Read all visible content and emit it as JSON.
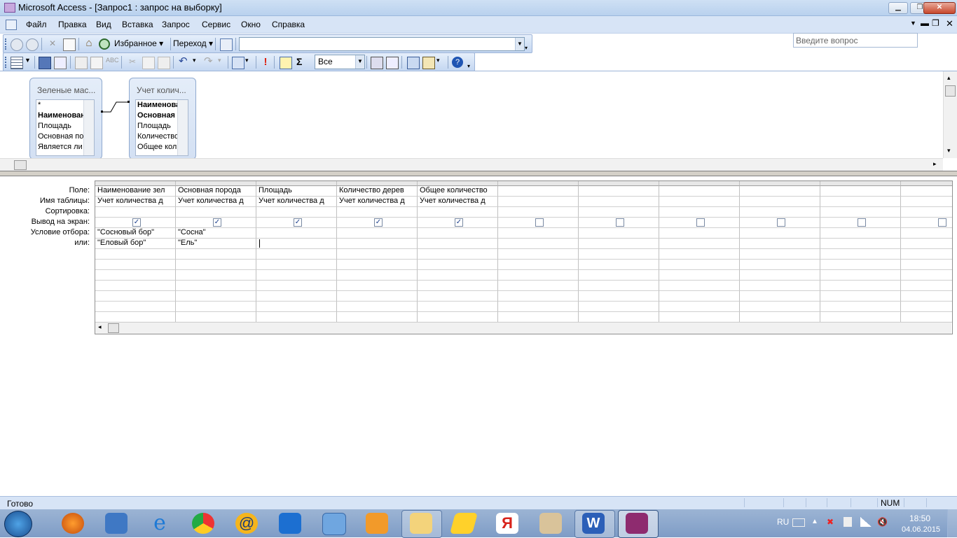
{
  "window": {
    "title": "Microsoft Access - [Запрос1 : запрос на выборку]"
  },
  "menu": {
    "items": [
      "Файл",
      "Правка",
      "Вид",
      "Вставка",
      "Запрос",
      "Сервис",
      "Окно",
      "Справка"
    ]
  },
  "help_box": {
    "placeholder": "Введите вопрос"
  },
  "toolbar1": {
    "favorites": "Избранное",
    "goto": "Переход"
  },
  "toolbar2": {
    "topvalues": "Все",
    "sigma": "Σ"
  },
  "tables": [
    {
      "header": "Зеленые мас...",
      "fields": [
        "*",
        "Наименовани",
        "Площадь",
        "Основная пор",
        "Является ли"
      ],
      "bold": [
        1
      ]
    },
    {
      "header": "Учет колич...",
      "fields": [
        "Наименова",
        "Основная п",
        "Площадь",
        "Количество",
        "Общее коли"
      ],
      "bold": [
        0,
        1
      ]
    }
  ],
  "grid": {
    "row_labels": [
      "Поле:",
      "Имя таблицы:",
      "Сортировка:",
      "Вывод на экран:",
      "Условие отбора:",
      "или:"
    ],
    "columns": [
      {
        "field": "Наименование зел",
        "table": "Учет количества д",
        "show": true,
        "criteria": "\"Сосновый бор\"",
        "or": "\"Еловый бор\""
      },
      {
        "field": "Основная порода",
        "table": "Учет количества д",
        "show": true,
        "criteria": "\"Сосна\"",
        "or": "\"Ель\""
      },
      {
        "field": "Площадь",
        "table": "Учет количества д",
        "show": true,
        "criteria": "",
        "or": ""
      },
      {
        "field": "Количество дерев",
        "table": "Учет количества д",
        "show": true,
        "criteria": "",
        "or": ""
      },
      {
        "field": "Общее количество",
        "table": "Учет количества д",
        "show": true,
        "criteria": "",
        "or": ""
      },
      {
        "field": "",
        "table": "",
        "show": false,
        "criteria": "",
        "or": ""
      },
      {
        "field": "",
        "table": "",
        "show": false,
        "criteria": "",
        "or": ""
      },
      {
        "field": "",
        "table": "",
        "show": false,
        "criteria": "",
        "or": ""
      },
      {
        "field": "",
        "table": "",
        "show": false,
        "criteria": "",
        "or": ""
      },
      {
        "field": "",
        "table": "",
        "show": false,
        "criteria": "",
        "or": ""
      },
      {
        "field": "",
        "table": "",
        "show": false,
        "criteria": "",
        "or": ""
      }
    ]
  },
  "status": {
    "text": "Готово",
    "num": "NUM"
  },
  "taskbar": {
    "lang": "RU",
    "time": "18:50",
    "date": "04.06.2015"
  }
}
